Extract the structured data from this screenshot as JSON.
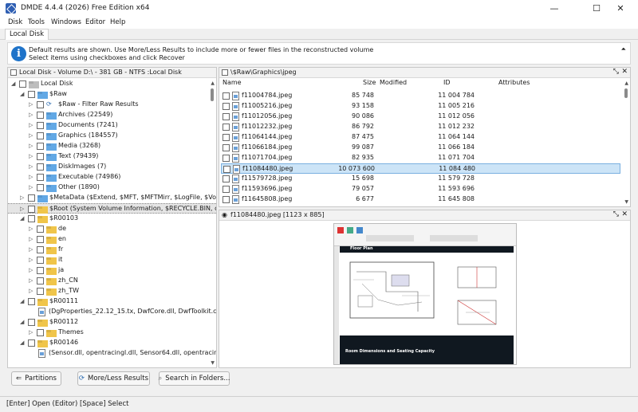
{
  "window": {
    "title": "DMDE 4.4.4 (2026) Free Edition x64",
    "minimize": "—",
    "maximize": "☐",
    "close": "✕"
  },
  "menu": [
    "Disk",
    "Tools",
    "Windows",
    "Editor",
    "Help"
  ],
  "tab": "Local Disk",
  "info": {
    "line1": "Default results are shown. Use More/Less Results to include more or fewer files in the reconstructed volume",
    "line2": "Select items using checkboxes and click Recover",
    "collapse": "⏶"
  },
  "left_panel": {
    "title": "Local Disk - Volume D:\\ - 381 GB - NTFS :Local Disk",
    "tree": [
      {
        "label": "Local Disk",
        "indent": 0,
        "tri": "◢",
        "icon": "folder-gray",
        "check": true
      },
      {
        "label": "$Raw",
        "indent": 1,
        "tri": "◢",
        "icon": "folder-blue",
        "check": true
      },
      {
        "label": "$Raw - Filter Raw Results",
        "indent": 2,
        "tri": "▷",
        "icon": "refresh",
        "check": true
      },
      {
        "label": "Archives (22549)",
        "indent": 2,
        "tri": "▷",
        "icon": "folder-blue",
        "check": true
      },
      {
        "label": "Documents (7241)",
        "indent": 2,
        "tri": "▷",
        "icon": "folder-blue",
        "check": true
      },
      {
        "label": "Graphics (184557)",
        "indent": 2,
        "tri": "▷",
        "icon": "folder-blue",
        "check": true
      },
      {
        "label": "Media (3268)",
        "indent": 2,
        "tri": "▷",
        "icon": "folder-blue",
        "check": true
      },
      {
        "label": "Text (79439)",
        "indent": 2,
        "tri": "▷",
        "icon": "folder-blue",
        "check": true
      },
      {
        "label": "DiskImages (7)",
        "indent": 2,
        "tri": "▷",
        "icon": "folder-blue",
        "check": true
      },
      {
        "label": "Executable (74986)",
        "indent": 2,
        "tri": "▷",
        "icon": "folder-blue",
        "check": true
      },
      {
        "label": "Other (1890)",
        "indent": 2,
        "tri": "▷",
        "icon": "folder-blue",
        "check": true
      },
      {
        "label": "$MetaData ($Extend, $MFT, $MFTMirr, $LogFile, $Volu",
        "indent": 1,
        "tri": "▷",
        "icon": "folder-blue",
        "check": true
      },
      {
        "label": "$Root (System Volume Information, $RECYCLE.BIN, ofl",
        "indent": 1,
        "tri": "▷",
        "icon": "folder-yellow",
        "check": true,
        "selected": true
      },
      {
        "label": "$R00103",
        "indent": 1,
        "tri": "◢",
        "icon": "folder-yellow",
        "check": true
      },
      {
        "label": "de",
        "indent": 2,
        "tri": "▷",
        "icon": "folder-yellow",
        "check": true
      },
      {
        "label": "en",
        "indent": 2,
        "tri": "▷",
        "icon": "folder-yellow",
        "check": true
      },
      {
        "label": "fr",
        "indent": 2,
        "tri": "▷",
        "icon": "folder-yellow",
        "check": true
      },
      {
        "label": "it",
        "indent": 2,
        "tri": "▷",
        "icon": "folder-yellow",
        "check": true
      },
      {
        "label": "ja",
        "indent": 2,
        "tri": "▷",
        "icon": "folder-yellow",
        "check": true
      },
      {
        "label": "zh_CN",
        "indent": 2,
        "tri": "▷",
        "icon": "folder-yellow",
        "check": true
      },
      {
        "label": "zh_TW",
        "indent": 2,
        "tri": "▷",
        "icon": "folder-yellow",
        "check": true
      },
      {
        "label": "$R00111",
        "indent": 1,
        "tri": "◢",
        "icon": "folder-yellow",
        "check": true
      },
      {
        "label": "(DgProperties_22.12_15.tx, DwfCore.dll, DwfToolkit.c",
        "indent": 2,
        "tri": "",
        "icon": "files",
        "check": false
      },
      {
        "label": "$R00112",
        "indent": 1,
        "tri": "◢",
        "icon": "folder-yellow",
        "check": true
      },
      {
        "label": "Themes",
        "indent": 2,
        "tri": "▷",
        "icon": "folder-yellow",
        "check": true
      },
      {
        "label": "$R00146",
        "indent": 1,
        "tri": "◢",
        "icon": "folder-yellow",
        "check": true
      },
      {
        "label": "(Sensor.dll, opentracingl.dll, Sensor64.dll, opentracin",
        "indent": 2,
        "tri": "",
        "icon": "files",
        "check": false
      }
    ]
  },
  "file_panel": {
    "path": "\\$Raw\\Graphics\\jpeg",
    "columns": {
      "name": "Name",
      "size": "Size",
      "modified": "Modified",
      "id": "ID",
      "attributes": "Attributes"
    },
    "rows": [
      {
        "name": "f11004784.jpeg",
        "size": "85 748",
        "id": "11 004 784"
      },
      {
        "name": "f11005216.jpeg",
        "size": "93 158",
        "id": "11 005 216"
      },
      {
        "name": "f11012056.jpeg",
        "size": "90 086",
        "id": "11 012 056"
      },
      {
        "name": "f11012232.jpeg",
        "size": "86 792",
        "id": "11 012 232"
      },
      {
        "name": "f11064144.jpeg",
        "size": "87 475",
        "id": "11 064 144"
      },
      {
        "name": "f11066184.jpeg",
        "size": "99 087",
        "id": "11 066 184"
      },
      {
        "name": "f11071704.jpeg",
        "size": "82 935",
        "id": "11 071 704"
      },
      {
        "name": "f11084480.jpeg",
        "size": "10 073 600",
        "id": "11 084 480",
        "selected": true
      },
      {
        "name": "f11579728.jpeg",
        "size": "15 698",
        "id": "11 579 728"
      },
      {
        "name": "f11593696.jpeg",
        "size": "79 057",
        "id": "11 593 696"
      },
      {
        "name": "f11645808.jpeg",
        "size": "6 677",
        "id": "11 645 808"
      }
    ]
  },
  "preview_panel": {
    "title": "f11084480.jpeg [1123 x 885]",
    "image_text": {
      "floor_plan": "Floor Plan",
      "caption": "Room Dimensions and Seating Capacity"
    }
  },
  "buttons": {
    "partitions": "Partitions",
    "more_less": "More/Less Results",
    "search": "Search in Folders..."
  },
  "status": "[Enter] Open (Editor)  [Space] Select",
  "panel_buttons": {
    "expand": "⤡",
    "close": "✕"
  }
}
